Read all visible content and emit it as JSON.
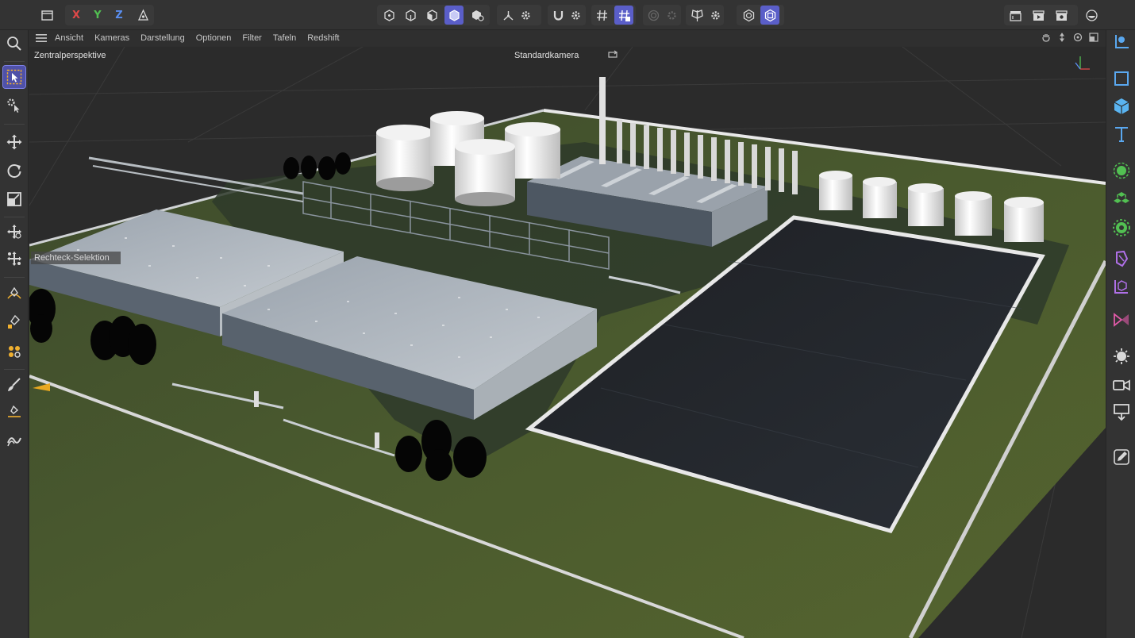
{
  "toolbar": {
    "axis_x": "X",
    "axis_y": "Y",
    "axis_z": "Z",
    "colors": {
      "x": "#e04848",
      "y": "#52c052",
      "z": "#5a8ef0",
      "accent": "#5a5ec8"
    }
  },
  "viewport_menu": {
    "items": [
      "Ansicht",
      "Kameras",
      "Darstellung",
      "Optionen",
      "Filter",
      "Tafeln",
      "Redshift"
    ]
  },
  "viewport": {
    "projection_label": "Zentralperspektive",
    "camera_label": "Standardkamera",
    "tooltip": "Rechteck-Selektion"
  },
  "left_tools": [
    "search-icon",
    "select-icon",
    "object-select-icon",
    "move-icon",
    "rotate-icon",
    "scale-icon",
    "transfer-icon",
    "multi-move-icon",
    "spline-pen-icon",
    "spline-draw-icon",
    "polygon-pen-icon",
    "brush-icon",
    "knife-icon",
    "twist-icon"
  ],
  "right_tools": [
    "coordinate-icon",
    "rectangle-icon",
    "cube-icon",
    "text-icon",
    "generator-icon",
    "cloner-icon",
    "effector-icon",
    "deformer-icon",
    "null-icon",
    "field-icon",
    "light-icon",
    "camera-icon",
    "floor-icon",
    "tag-icon"
  ]
}
